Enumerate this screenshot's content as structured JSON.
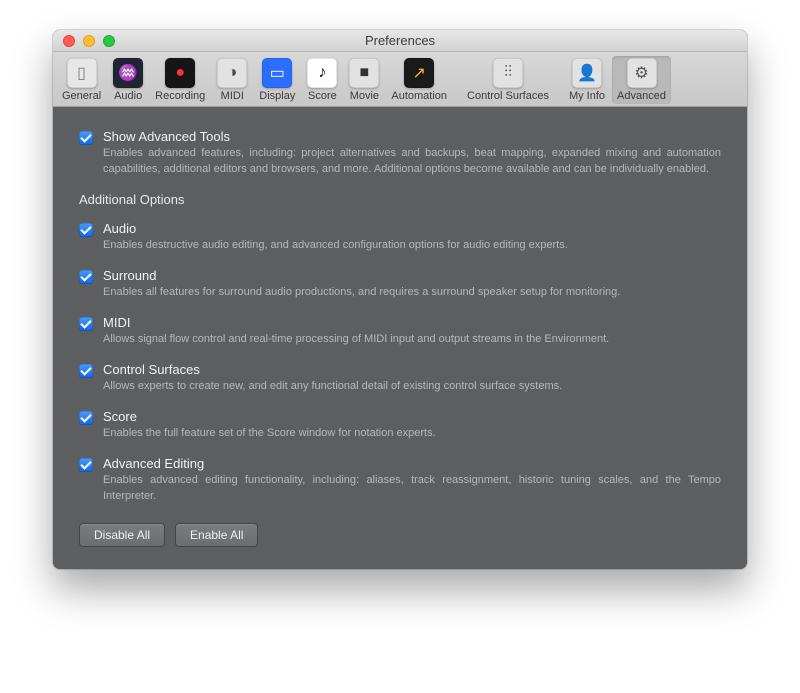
{
  "window": {
    "title": "Preferences"
  },
  "toolbar": [
    {
      "name": "general",
      "label": "General",
      "bg": "#e7e7e7",
      "glyph": "▯",
      "gcolor": "#7a7a7a"
    },
    {
      "name": "audio",
      "label": "Audio",
      "bg": "#1f2532",
      "glyph": "♒",
      "gcolor": "#4aa3ff"
    },
    {
      "name": "recording",
      "label": "Recording",
      "bg": "#161616",
      "glyph": "●",
      "gcolor": "#ff3232"
    },
    {
      "name": "midi",
      "label": "MIDI",
      "bg": "#e2e2e2",
      "glyph": "◑",
      "gcolor": "#444"
    },
    {
      "name": "display",
      "label": "Display",
      "bg": "#2a6dff",
      "glyph": "▭",
      "gcolor": "#fff"
    },
    {
      "name": "score",
      "label": "Score",
      "bg": "#ffffff",
      "glyph": "♪",
      "gcolor": "#111"
    },
    {
      "name": "movie",
      "label": "Movie",
      "bg": "#e2e2e2",
      "glyph": "■",
      "gcolor": "#333"
    },
    {
      "name": "automation",
      "label": "Automation",
      "bg": "#1a1a1a",
      "glyph": "↗",
      "gcolor": "#ffb03a"
    },
    {
      "name": "control-surfaces",
      "label": "Control Surfaces",
      "bg": "#e2e2e2",
      "glyph": "⫶⫶",
      "gcolor": "#555"
    },
    {
      "name": "my-info",
      "label": "My Info",
      "bg": "#e2e2e2",
      "glyph": "👤",
      "gcolor": "#555"
    },
    {
      "name": "advanced",
      "label": "Advanced",
      "bg": "#e2e2e2",
      "glyph": "⚙",
      "gcolor": "#555",
      "selected": true
    }
  ],
  "main": {
    "show_advanced": {
      "title": "Show Advanced Tools",
      "desc": "Enables advanced features, including: project alternatives and backups, beat mapping, expanded mixing and automation capabilities, additional editors and browsers, and more. Additional options become available and can be individually enabled."
    },
    "additional_heading": "Additional Options",
    "options": [
      {
        "name": "audio",
        "title": "Audio",
        "desc": "Enables destructive audio editing, and advanced configuration options for audio editing experts."
      },
      {
        "name": "surround",
        "title": "Surround",
        "desc": "Enables all features for surround audio productions, and requires a surround speaker setup for monitoring."
      },
      {
        "name": "midi",
        "title": "MIDI",
        "desc": "Allows signal flow control and real-time processing of MIDI input and output streams in the Environment."
      },
      {
        "name": "control-surfaces",
        "title": "Control Surfaces",
        "desc": "Allows experts to create new, and edit any functional detail of existing control surface systems."
      },
      {
        "name": "score",
        "title": "Score",
        "desc": "Enables the full feature set of the Score window for notation experts."
      },
      {
        "name": "advanced-editing",
        "title": "Advanced Editing",
        "desc": "Enables advanced editing functionality, including: aliases, track reassignment, historic tuning scales, and the Tempo Interpreter."
      }
    ],
    "buttons": {
      "disable": "Disable All",
      "enable": "Enable All"
    }
  }
}
